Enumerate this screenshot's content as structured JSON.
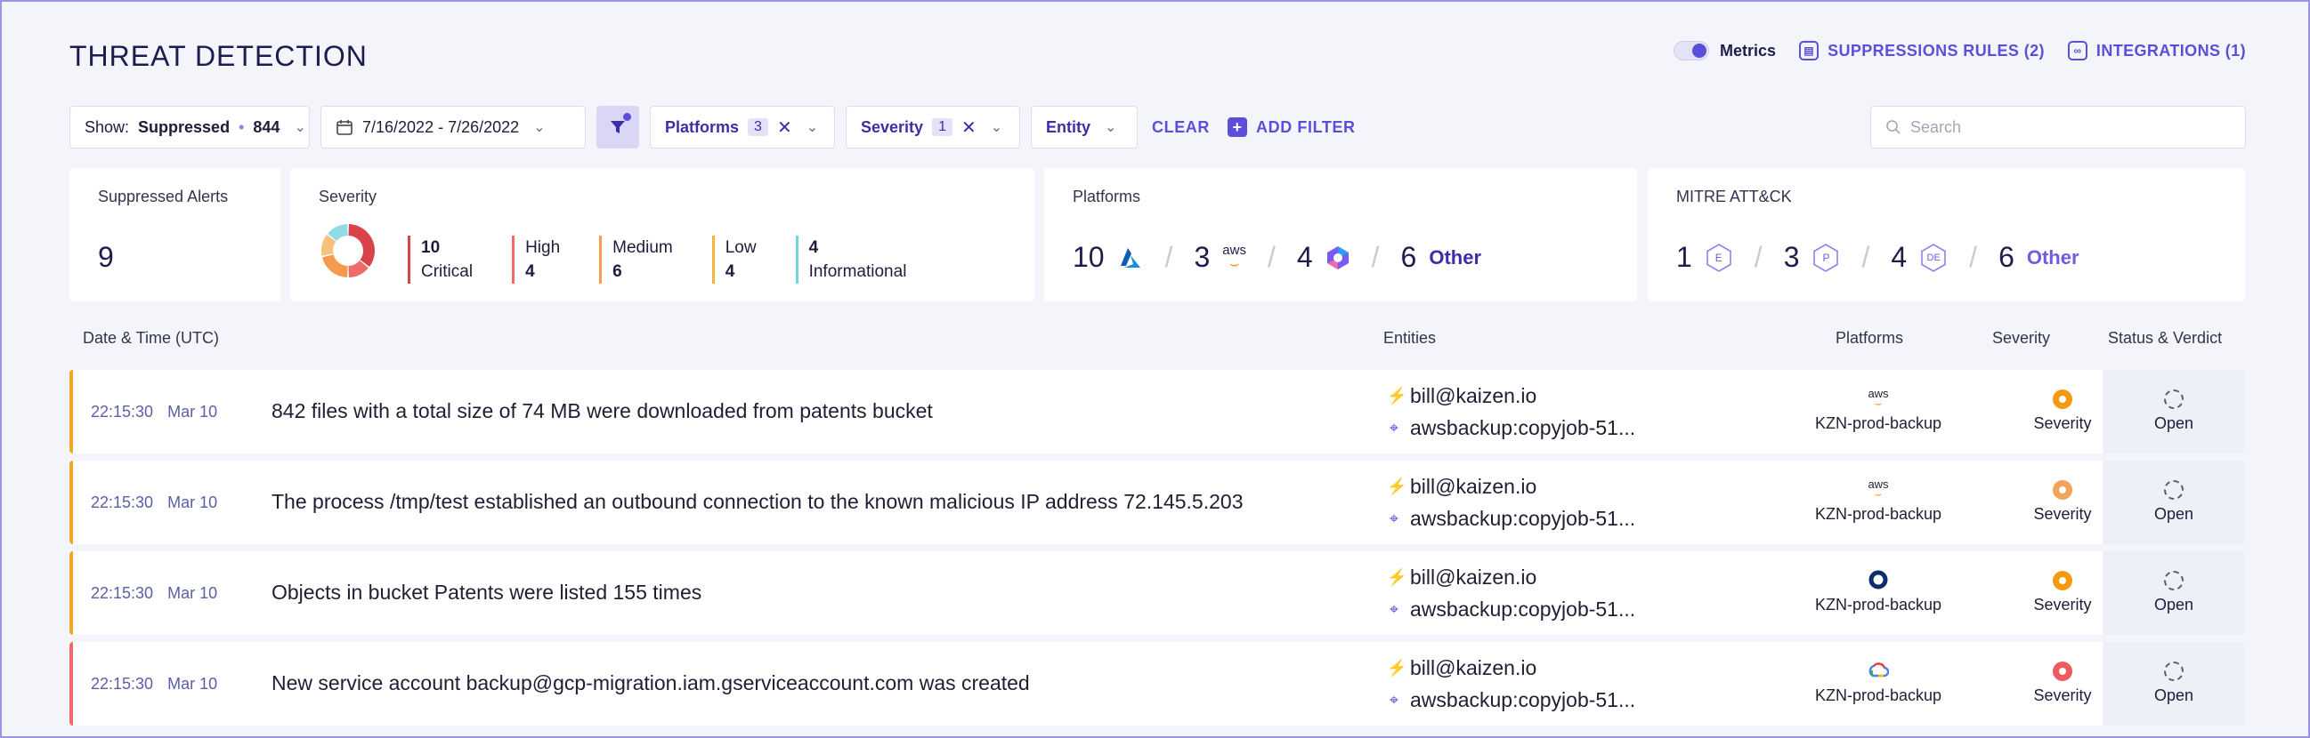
{
  "header": {
    "title": "THREAT DETECTION",
    "metrics_label": "Metrics",
    "suppressions_label": "SUPPRESSIONS RULES (2)",
    "integrations_label": "INTEGRATIONS (1)"
  },
  "filters": {
    "show_prefix": "Show:",
    "show_value": "Suppressed",
    "show_count": "844",
    "date_range": "7/16/2022 - 7/26/2022",
    "chips": [
      {
        "label": "Platforms",
        "count": "3"
      },
      {
        "label": "Severity",
        "count": "1"
      }
    ],
    "entity_label": "Entity",
    "clear_label": "CLEAR",
    "add_filter_label": "ADD FILTER",
    "search_placeholder": "Search"
  },
  "summary": {
    "suppressed": {
      "title": "Suppressed Alerts",
      "value": "9"
    },
    "severity": {
      "title": "Severity",
      "items": [
        {
          "count": "10",
          "label": "Critical",
          "color": "#d9434a"
        },
        {
          "count": "4",
          "label": "High",
          "color": "#f06a6a"
        },
        {
          "count": "6",
          "label": "Medium",
          "color": "#f59a4f"
        },
        {
          "count": "4",
          "label": "Low",
          "color": "#f5b43b"
        },
        {
          "count": "4",
          "label": "Informational",
          "color": "#6fd3e0"
        }
      ],
      "donut": [
        {
          "value": 10,
          "color": "#d9434a"
        },
        {
          "value": 4,
          "color": "#f06a6a"
        },
        {
          "value": 6,
          "color": "#f59a4f"
        },
        {
          "value": 4,
          "color": "#f5c27a"
        },
        {
          "value": 4,
          "color": "#8fdbe6"
        }
      ]
    },
    "platforms": {
      "title": "Platforms",
      "items": [
        {
          "count": "10",
          "icon": "azure-icon"
        },
        {
          "count": "3",
          "icon": "aws-icon",
          "text": "aws"
        },
        {
          "count": "4",
          "icon": "office-icon"
        },
        {
          "count": "6",
          "text": "Other"
        }
      ]
    },
    "mitre": {
      "title": "MITRE ATT&CK",
      "items": [
        {
          "count": "1",
          "letter": "E"
        },
        {
          "count": "3",
          "letter": "P"
        },
        {
          "count": "4",
          "letter": "DE"
        },
        {
          "count": "6",
          "text": "Other"
        }
      ]
    }
  },
  "table": {
    "headers": {
      "datetime": "Date & Time (UTC)",
      "entities": "Entities",
      "platforms": "Platforms",
      "severity": "Severity",
      "status": "Status & Verdict"
    },
    "rows": [
      {
        "time": "22:15:30",
        "date": "Mar 10",
        "description": "842 files with a total size of 74 MB were downloaded from patents bucket",
        "entity1": "bill@kaizen.io",
        "entity2": "awsbackup:copyjob-51...",
        "platform_icon": "aws",
        "platform": "KZN-prod-backup",
        "severity": "Severity",
        "severity_color": "#f59a10",
        "status": "Open",
        "bar_color": "#f2a623"
      },
      {
        "time": "22:15:30",
        "date": "Mar 10",
        "description": "The process /tmp/test established an outbound connection to the known malicious IP address 72.145.5.203",
        "entity1": "bill@kaizen.io",
        "entity2": "awsbackup:copyjob-51...",
        "platform_icon": "aws",
        "platform": "KZN-prod-backup",
        "severity": "Severity",
        "severity_color": "#f5a25a",
        "status": "Open",
        "bar_color": "#f2a623"
      },
      {
        "time": "22:15:30",
        "date": "Mar 10",
        "description": "Objects in bucket Patents were listed 155 times",
        "entity1": "bill@kaizen.io",
        "entity2": "awsbackup:copyjob-51...",
        "platform_icon": "ring",
        "platform": "KZN-prod-backup",
        "severity": "Severity",
        "severity_color": "#f59a10",
        "status": "Open",
        "bar_color": "#f2a623"
      },
      {
        "time": "22:15:30",
        "date": "Mar 10",
        "description": "New service account backup@gcp-migration.iam.gserviceaccount.com was created",
        "entity1": "bill@kaizen.io",
        "entity2": "awsbackup:copyjob-51...",
        "platform_icon": "gcp",
        "platform": "KZN-prod-backup",
        "severity": "Severity",
        "severity_color": "#f0595e",
        "status": "Open",
        "bar_color": "#f06a6a"
      }
    ]
  }
}
